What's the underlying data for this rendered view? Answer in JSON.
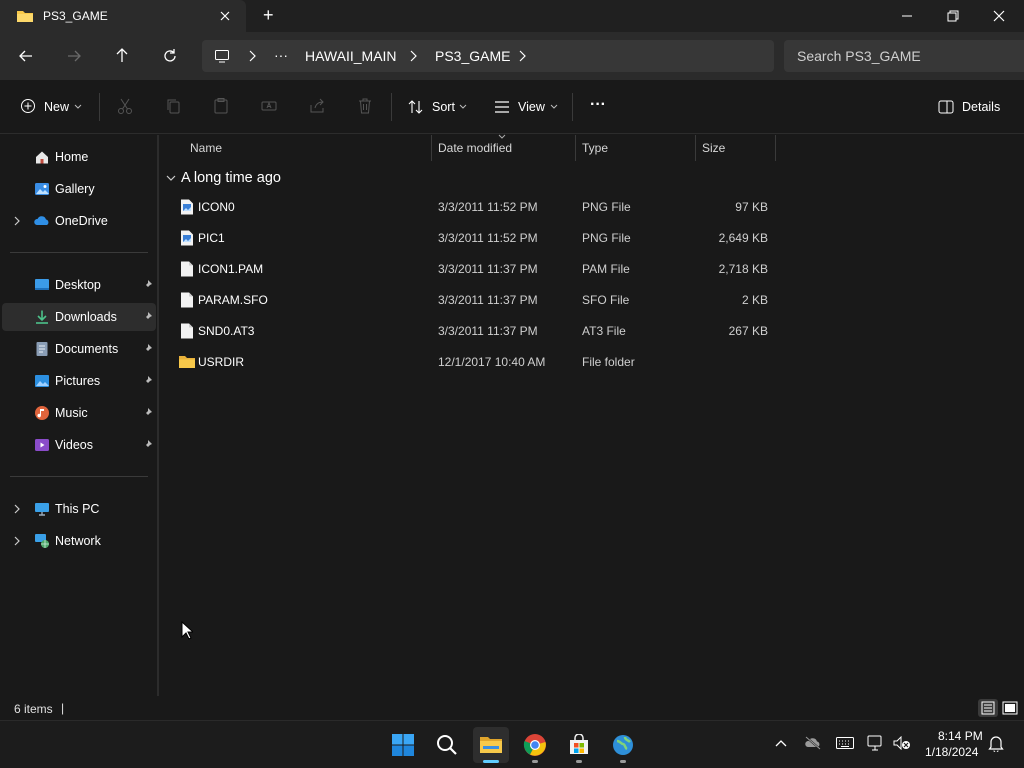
{
  "window": {
    "tab_title": "PS3_GAME",
    "new_tab_symbol": "+"
  },
  "address": {
    "overflow": "···",
    "crumbs": [
      "HAWAII_MAIN",
      "PS3_GAME"
    ],
    "search_placeholder": "Search PS3_GAME"
  },
  "toolbar": {
    "new_label": "New",
    "sort_label": "Sort",
    "view_label": "View",
    "more_label": "···",
    "details_label": "Details"
  },
  "sidebar": {
    "quick": [
      {
        "label": "Home",
        "icon": "home-icon"
      },
      {
        "label": "Gallery",
        "icon": "gallery-icon"
      },
      {
        "label": "OneDrive",
        "icon": "onedrive-icon",
        "expandable": true
      }
    ],
    "pinned": [
      {
        "label": "Desktop",
        "icon": "desktop-icon"
      },
      {
        "label": "Downloads",
        "icon": "downloads-icon",
        "selected": true
      },
      {
        "label": "Documents",
        "icon": "documents-icon"
      },
      {
        "label": "Pictures",
        "icon": "pictures-icon"
      },
      {
        "label": "Music",
        "icon": "music-icon"
      },
      {
        "label": "Videos",
        "icon": "videos-icon"
      }
    ],
    "devices": [
      {
        "label": "This PC",
        "icon": "this-pc-icon",
        "expandable": true
      },
      {
        "label": "Network",
        "icon": "network-icon",
        "expandable": true
      }
    ]
  },
  "filelist": {
    "columns": [
      "Name",
      "Date modified",
      "Type",
      "Size"
    ],
    "group_label": "A long time ago",
    "rows": [
      {
        "name": "ICON0",
        "date": "3/3/2011 11:52 PM",
        "type": "PNG File",
        "size": "97 KB",
        "kind": "image"
      },
      {
        "name": "PIC1",
        "date": "3/3/2011 11:52 PM",
        "type": "PNG File",
        "size": "2,649 KB",
        "kind": "image"
      },
      {
        "name": "ICON1.PAM",
        "date": "3/3/2011 11:37 PM",
        "type": "PAM File",
        "size": "2,718 KB",
        "kind": "file"
      },
      {
        "name": "PARAM.SFO",
        "date": "3/3/2011 11:37 PM",
        "type": "SFO File",
        "size": "2 KB",
        "kind": "file"
      },
      {
        "name": "SND0.AT3",
        "date": "3/3/2011 11:37 PM",
        "type": "AT3 File",
        "size": "267 KB",
        "kind": "file"
      },
      {
        "name": "USRDIR",
        "date": "12/1/2017 10:40 AM",
        "type": "File folder",
        "size": "",
        "kind": "folder"
      }
    ]
  },
  "status": {
    "item_count": "6 items",
    "separator": "|"
  },
  "taskbar": {
    "time": "8:14 PM",
    "date": "1/18/2024",
    "apps": [
      "start-icon",
      "search-icon",
      "file-explorer-icon",
      "chrome-icon",
      "store-icon",
      "maps-icon"
    ]
  },
  "colors": {
    "accent": "#60cdff",
    "folder": "#f8c94a",
    "background": "#191919"
  }
}
